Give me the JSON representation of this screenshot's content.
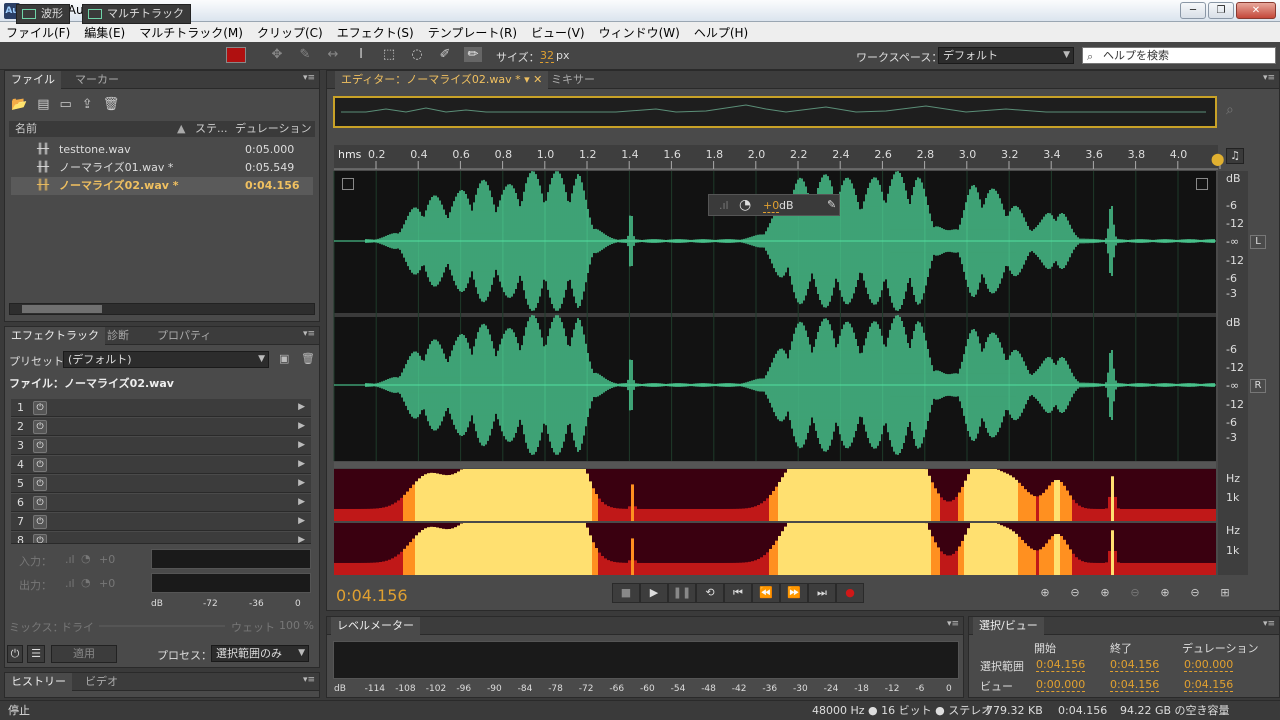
{
  "window": {
    "app_icon": "Au",
    "title": "Adobe Audition",
    "min": "─",
    "max": "❐",
    "close": "✕"
  },
  "menu": [
    "ファイル(F)",
    "編集(E)",
    "マルチトラック(M)",
    "クリップ(C)",
    "エフェクト(S)",
    "テンプレート(R)",
    "ビュー(V)",
    "ウィンドウ(W)",
    "ヘルプ(H)"
  ],
  "toolbar": {
    "waveform_label": "波形",
    "multitrack_label": "マルチトラック",
    "size_label": "サイズ：",
    "size_value": "32",
    "size_unit": "px",
    "workspace_label": "ワークスペース：",
    "workspace_value": "デフォルト",
    "search_placeholder": "ヘルプを検索"
  },
  "files_panel": {
    "tabs": [
      "ファイル",
      "マーカー"
    ],
    "col_name": "名前",
    "col_status": "ステ...",
    "col_duration": "デュレーション",
    "files": [
      {
        "name": "testtone.wav",
        "duration": "0:05.000"
      },
      {
        "name": "ノーマライズ01.wav *",
        "duration": "0:05.549"
      },
      {
        "name": "ノーマライズ02.wav *",
        "duration": "0:04.156"
      }
    ]
  },
  "effects_panel": {
    "tabs": [
      "エフェクトラック",
      "診断",
      "プロパティ"
    ],
    "preset_label": "プリセット：",
    "preset_value": "(デフォルト)",
    "file_label": "ファイル：ノーマライズ02.wav",
    "slots": [
      "1",
      "2",
      "3",
      "4",
      "5",
      "6",
      "7",
      "8"
    ],
    "input_label": "入力：",
    "output_label": "出力：",
    "input_value": "+0",
    "output_value": "+0",
    "meter_scale": [
      "dB",
      "-72",
      "-36",
      "0"
    ],
    "mix_label": "ミックス：",
    "mix_dry": "ドライ",
    "mix_wet": "ウェット",
    "mix_value": "100 %",
    "apply_label": "適用",
    "process_label": "プロセス：",
    "process_value": "選択範囲のみ"
  },
  "history_panel": {
    "tabs": [
      "ヒストリー",
      "ビデオ"
    ]
  },
  "editor": {
    "tabs": [
      "エディター：ノーマライズ02.wav *",
      "ミキサー"
    ],
    "ruler_unit": "hms",
    "ruler_ticks": [
      "0.2",
      "0.4",
      "0.6",
      "0.8",
      "1.0",
      "1.2",
      "1.4",
      "1.6",
      "1.8",
      "2.0",
      "2.2",
      "2.4",
      "2.6",
      "2.8",
      "3.0",
      "3.2",
      "3.4",
      "3.6",
      "3.8",
      "4.0"
    ],
    "db_scale": [
      "dB",
      "-6",
      "-12",
      "-∞",
      "-12",
      "-6",
      "-3"
    ],
    "channel_L": "L",
    "channel_R": "R",
    "hz_label": "Hz",
    "k_label": "1k",
    "hud_value": "+0",
    "hud_unit": "dB",
    "time": "0:04.156"
  },
  "level_meter": {
    "title": "レベルメーター",
    "scale": [
      "dB",
      "-114",
      "-108",
      "-102",
      "-96",
      "-90",
      "-84",
      "-78",
      "-72",
      "-66",
      "-60",
      "-54",
      "-48",
      "-42",
      "-36",
      "-30",
      "-24",
      "-18",
      "-12",
      "-6",
      "0"
    ]
  },
  "selection_view": {
    "title": "選択/ビュー",
    "col_start": "開始",
    "col_end": "終了",
    "col_duration": "デュレーション",
    "row_selection": "選択範囲",
    "row_view": "ビュー",
    "sel_start": "0:04.156",
    "sel_end": "0:04.156",
    "sel_duration": "0:00.000",
    "view_start": "0:00.000",
    "view_end": "0:04.156",
    "view_duration": "0:04.156"
  },
  "status": {
    "left": "停止",
    "sample_rate": "48000 Hz ● 16 ビット ● ステレオ",
    "size": "779.32 KB",
    "duration": "0:04.156",
    "free": "94.22 GB の空き容量"
  }
}
